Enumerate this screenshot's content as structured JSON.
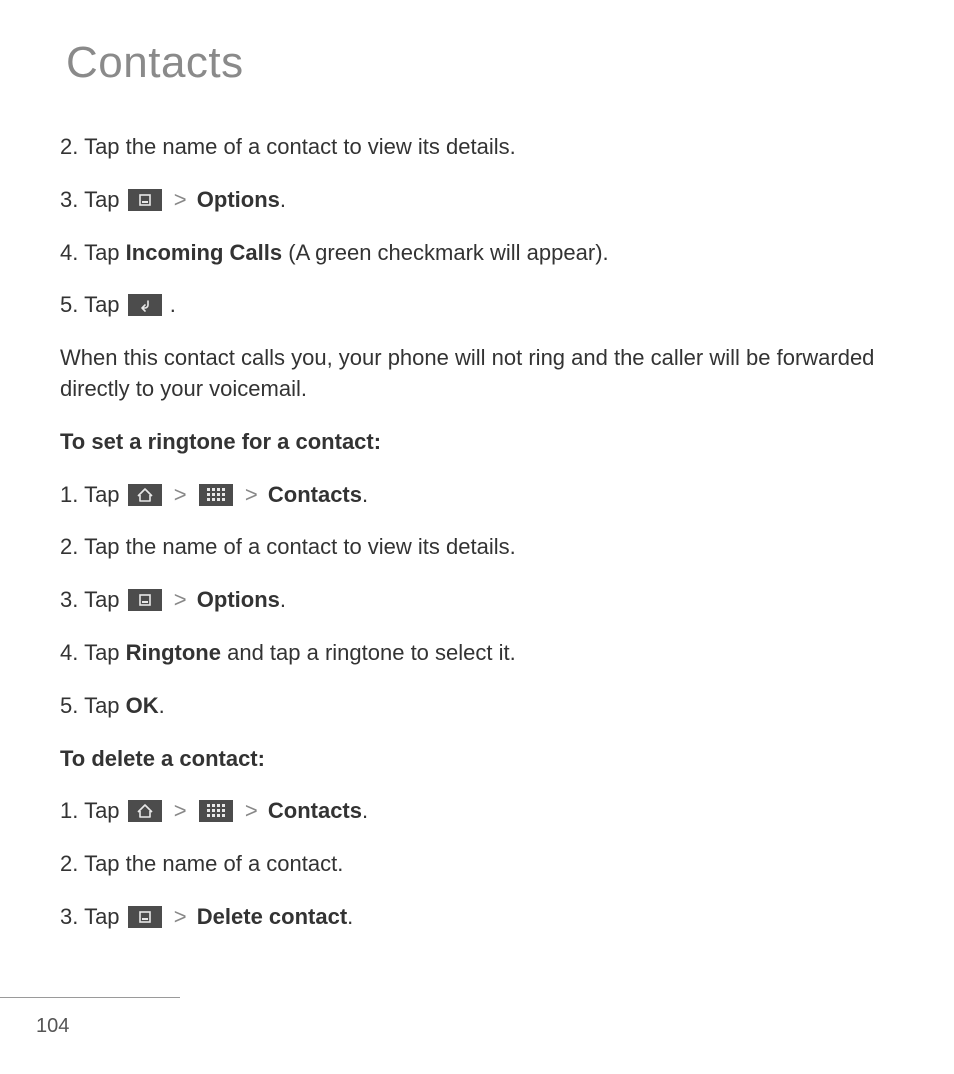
{
  "title": "Contacts",
  "page_number": "104",
  "sep": ">",
  "period": ".",
  "paren_open": " (",
  "paren_close": ").",
  "sectionA": {
    "s2": {
      "pre": "2. Tap the name of a contact to view its details."
    },
    "s3": {
      "pre": "3. Tap ",
      "opt": "Options"
    },
    "s4": {
      "pre": "4. Tap ",
      "bold": "Incoming Calls",
      "post": "A green checkmark will appear"
    },
    "s5": {
      "pre": "5. Tap "
    },
    "note": "When this contact calls you, your phone will not ring and the caller will be forwarded directly to your voicemail."
  },
  "sectionB": {
    "heading": "To set a ringtone for a contact:",
    "s1": {
      "pre": "1. Tap ",
      "contacts": "Contacts"
    },
    "s2": {
      "pre": "2. Tap the name of a contact to view its details."
    },
    "s3": {
      "pre": "3. Tap ",
      "opt": "Options"
    },
    "s4": {
      "pre": "4. Tap ",
      "bold": "Ringtone",
      "post": " and tap a ringtone to select it."
    },
    "s5": {
      "pre": "5. Tap ",
      "ok": "OK"
    }
  },
  "sectionC": {
    "heading": "To delete a contact:",
    "s1": {
      "pre": "1. Tap ",
      "contacts": "Contacts"
    },
    "s2": {
      "pre": "2. Tap the name of a contact."
    },
    "s3": {
      "pre": "3. Tap ",
      "del": "Delete contact"
    }
  }
}
